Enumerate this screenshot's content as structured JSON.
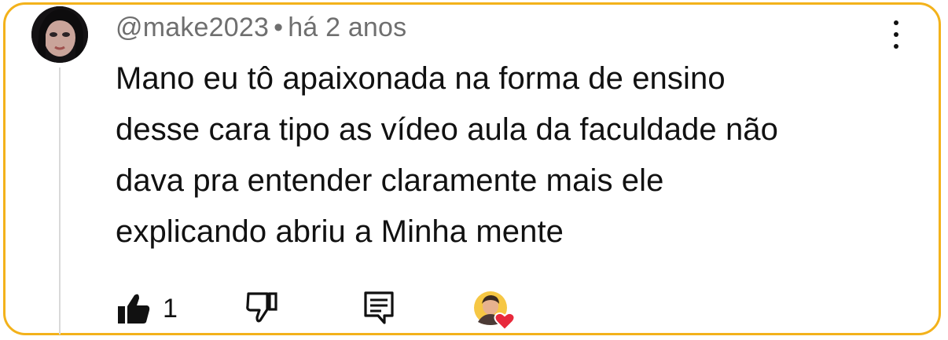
{
  "comment": {
    "author": "@make2023",
    "separator": "•",
    "timestamp": "há 2 anos",
    "lines": [
      "Mano eu tô apaixonada na forma de ensino",
      "desse cara tipo as vídeo aula da faculdade não",
      "dava pra entender claramente mais ele",
      "explicando abriu a Minha mente"
    ],
    "like_count": "1"
  },
  "icons": {
    "avatar": "user-avatar",
    "menu": "more-vert-icon",
    "like": "thumbs-up-filled-icon",
    "dislike": "thumbs-down-outline-icon",
    "reply": "comment-reply-icon",
    "creator_heart": "creator-heart-icon"
  },
  "colors": {
    "border_accent": "#f3b21b",
    "meta_text": "#6f6f6f",
    "body_text": "#111111",
    "heart": "#e8293b"
  }
}
